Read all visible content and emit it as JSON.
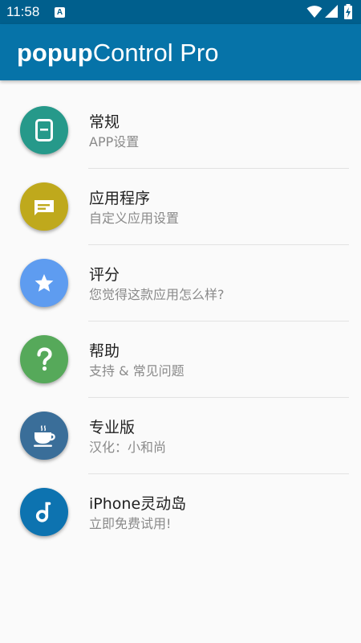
{
  "status_bar": {
    "time": "11:58",
    "notification_label": "A",
    "icons": [
      "wifi-icon",
      "signal-icon",
      "battery-charging-icon"
    ]
  },
  "app_bar": {
    "title_bold": "popup",
    "title_regular": "Control Pro",
    "background_color": "#0673a8"
  },
  "menu": {
    "items": [
      {
        "title": "常规",
        "subtitle": "APP设置",
        "icon": "phone-icon",
        "color": "#26998a"
      },
      {
        "title": "应用程序",
        "subtitle": "自定义应用设置",
        "icon": "message-icon",
        "color": "#bfa91c"
      },
      {
        "title": "评分",
        "subtitle": "您觉得这款应用怎么样?",
        "icon": "star-icon",
        "color": "#5e9cf0"
      },
      {
        "title": "帮助",
        "subtitle": "支持 & 常见问题",
        "icon": "question-icon",
        "color": "#56a95a"
      },
      {
        "title": "专业版",
        "subtitle": "汉化：小和尚",
        "icon": "coffee-cup-icon",
        "color": "#3a6e99"
      },
      {
        "title": "iPhone灵动岛",
        "subtitle": "立即免费试用!",
        "icon": "music-note-icon",
        "color": "#0d73b0"
      }
    ]
  }
}
